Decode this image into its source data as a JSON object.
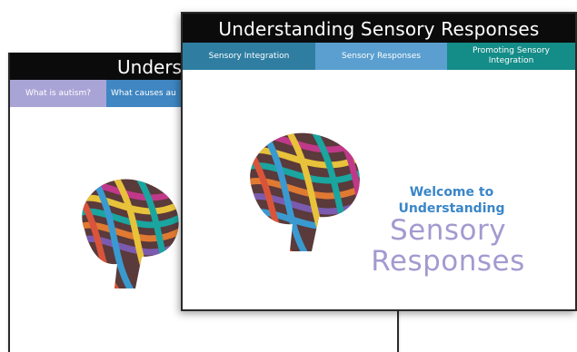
{
  "back_window": {
    "title": "Understa",
    "tabs": [
      {
        "label": "What is autism?",
        "color": "#a9a4d6"
      },
      {
        "label": "What causes au",
        "color": "#3f86c2"
      }
    ]
  },
  "front_window": {
    "title": "Understanding Sensory Responses",
    "tabs": [
      {
        "label": "Sensory Integration",
        "color": "#2f7ea2"
      },
      {
        "label": "Sensory Responses",
        "color": "#5a9fd0"
      },
      {
        "label": "Promoting Sensory Integration",
        "color": "#148c88"
      }
    ],
    "welcome_line1": "Welcome to",
    "welcome_line2": "Understanding",
    "heading_line1": "Sensory",
    "heading_line2": "Responses",
    "brain_icon": "brain-icon"
  },
  "colors": {
    "titlebar": "#0b0b0b",
    "welcome_text": "#3a86c8",
    "heading_text": "#a49ad0"
  }
}
